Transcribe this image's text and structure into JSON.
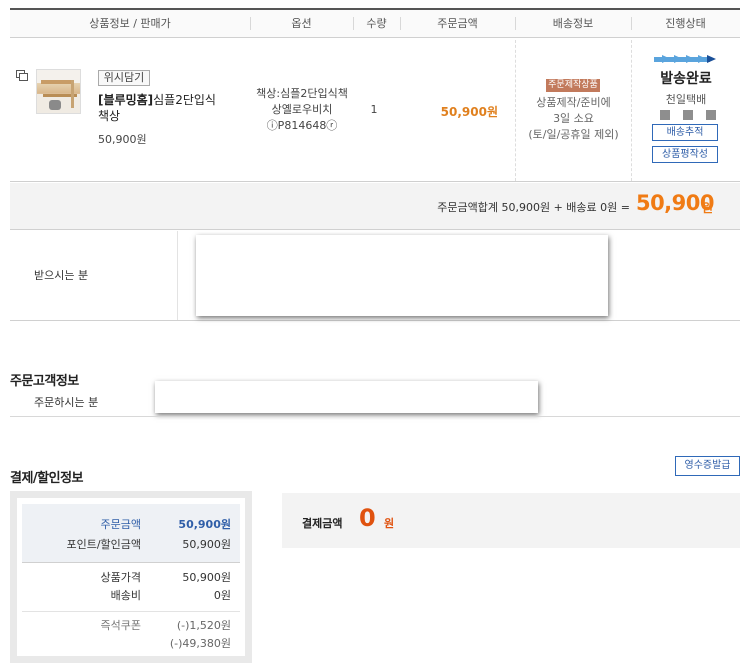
{
  "table": {
    "headers": {
      "product": "상품정보 / 판매가",
      "option": "옵션",
      "qty": "수량",
      "amount": "주문금액",
      "shipping": "배송정보",
      "status": "진행상태"
    }
  },
  "item": {
    "wish_label": "위시담기",
    "brand": "[블루밍홈]",
    "name_line1": "심플2단입식",
    "name_line2": "책상",
    "price": "50,900원",
    "option_line1": "책상:심플2단입식책",
    "option_line2": "상옐로우비치",
    "option_line3": "ⓘP814648ⓡ",
    "qty": "1",
    "amount": "50,900원",
    "ship_badge": "주문제작상품",
    "ship_line1": "상품제작/준비에",
    "ship_line2": "3일 소요",
    "ship_line3": "(토/일/공휴일 제외)",
    "status": "발송완료",
    "carrier": "천일택배",
    "track_button": "배송추적",
    "review_button": "상품평작성"
  },
  "totals": {
    "summary": "주문금액합계 50,900원 + 배송료 0원 =",
    "total": "50,900",
    "won": "원"
  },
  "recipient": {
    "label": "받으시는 분"
  },
  "customer": {
    "title": "주문고객정보",
    "label": "주문하시는 분"
  },
  "payment": {
    "title": "결제/할인정보",
    "receipt_button": "영수증발급",
    "order_amount_label": "주문금액",
    "order_amount_value": "50,900원",
    "points_label": "포인트/할인금액",
    "points_value": "50,900원",
    "goods_label": "상품가격",
    "goods_value": "50,900원",
    "shipping_label": "배송비",
    "shipping_value": "0원",
    "coupon_label": "즉석쿠폰",
    "coupon_value": "(-)1,520원",
    "extra_value": "(-)49,380원",
    "final_label": "결제금액",
    "final_amount": "0",
    "final_won": "원"
  },
  "colors": {
    "accent_orange": "#f07b14",
    "link_blue": "#2f5ea8",
    "ship_badge": "#c27a5c",
    "final_red": "#e0520f"
  }
}
